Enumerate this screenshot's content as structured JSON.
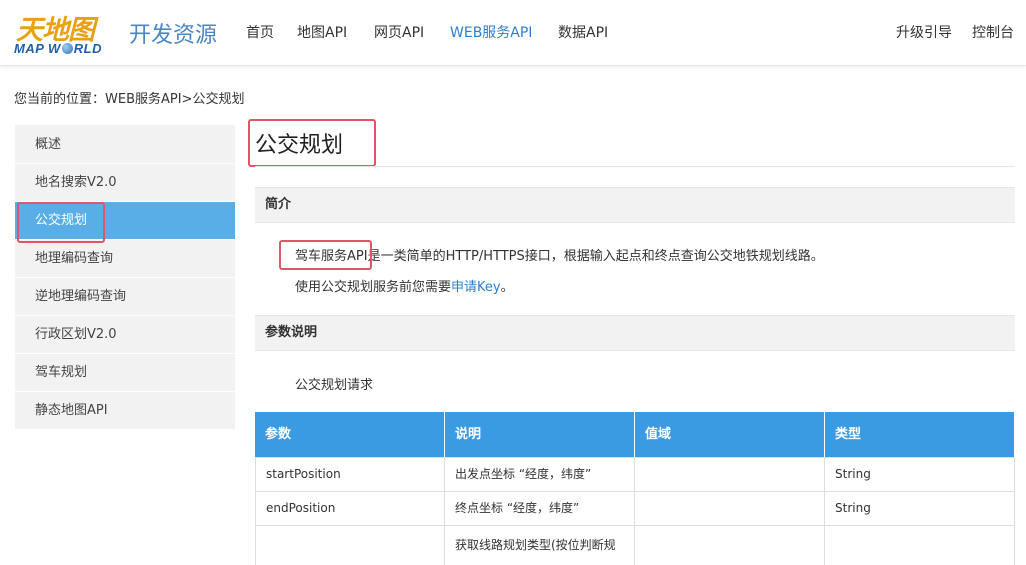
{
  "header": {
    "logo_cn": "天地图",
    "logo_en_left": "MAP W",
    "logo_en_right": "RLD",
    "brand": "开发资源",
    "nav": [
      "首页",
      "地图API",
      "网页API",
      "WEB服务API",
      "数据API"
    ],
    "nav_active": "WEB服务API",
    "right_nav": [
      "升级引导",
      "控制台"
    ]
  },
  "breadcrumb": "您当前的位置：WEB服务API>公交规划",
  "sidebar": {
    "items": [
      "概述",
      "地名搜索V2.0",
      "公交规划",
      "地理编码查询",
      "逆地理编码查询",
      "行政区划V2.0",
      "驾车规划",
      "静态地图API"
    ],
    "active_index": 2
  },
  "content": {
    "title": "公交规划",
    "intro_heading": "简介",
    "intro_line1_highlight": "驾车服务API",
    "intro_line1_rest": "是一类简单的HTTP/HTTPS接口，根据输入起点和终点查询公交地铁规划线路。",
    "intro_line2_prefix": "使用公交规划服务前您需要",
    "intro_line2_link": "申请Key",
    "intro_line2_suffix": "。",
    "params_heading": "参数说明",
    "params_subtitle": "公交规划请求"
  },
  "table": {
    "columns": [
      "参数",
      "说明",
      "值域",
      "类型"
    ],
    "rows": [
      [
        "startPosition",
        "出发点坐标 “经度，纬度”",
        "",
        "String"
      ],
      [
        "endPosition",
        "终点坐标 “经度，纬度”",
        "",
        "String"
      ],
      [
        "",
        "获取线路规划类型(按位判断规",
        "",
        ""
      ]
    ]
  },
  "colors": {
    "accent": "#2c7fd0",
    "sidebar_active": "#5aaee8",
    "table_header": "#3a9ae2",
    "highlight_box": "#e25562"
  }
}
